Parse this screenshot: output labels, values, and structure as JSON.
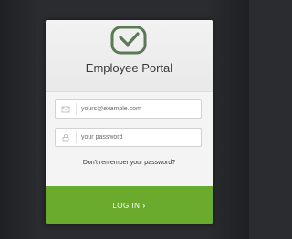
{
  "portal": {
    "title": "Employee Portal"
  },
  "email": {
    "value": "",
    "placeholder": "yours@example.com"
  },
  "password": {
    "value": "",
    "placeholder": "your password"
  },
  "forgot_link": "Don't remember your password?",
  "login_button": {
    "label": "LOG IN",
    "chevron": "›"
  },
  "colors": {
    "accent": "#6aab2e",
    "logo": "#5a7a55",
    "card": "#f4f4f4"
  },
  "icons": {
    "logo": "checkmark-badge-icon",
    "email": "envelope-icon",
    "password": "lock-icon"
  }
}
